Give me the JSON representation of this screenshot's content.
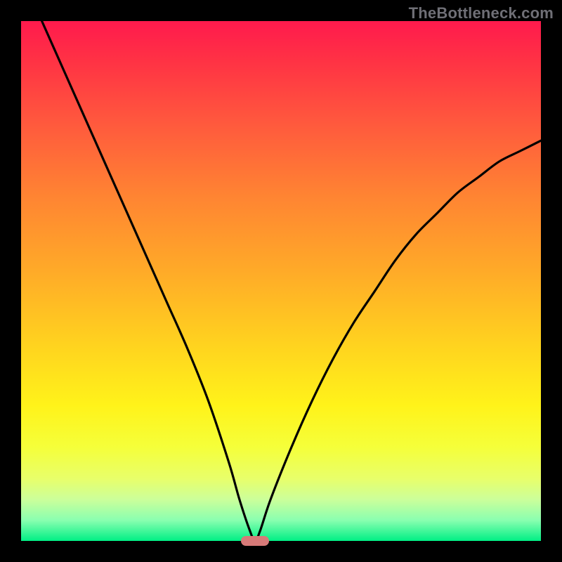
{
  "watermark": "TheBottleneck.com",
  "colors": {
    "frame": "#000000",
    "gradient_top": "#ff1a4d",
    "gradient_bottom": "#00ef85",
    "curve": "#000000",
    "marker": "#d77a78",
    "watermark": "#6f6f76"
  },
  "chart_data": {
    "type": "line",
    "title": "",
    "xlabel": "",
    "ylabel": "",
    "xlim": [
      0,
      100
    ],
    "ylim": [
      0,
      100
    ],
    "grid": false,
    "legend": false,
    "series": [
      {
        "name": "bottleneck-curve",
        "x": [
          4,
          8,
          12,
          16,
          20,
          24,
          28,
          32,
          36,
          40,
          42,
          44,
          45,
          46,
          48,
          52,
          56,
          60,
          64,
          68,
          72,
          76,
          80,
          84,
          88,
          92,
          96,
          100
        ],
        "values": [
          100,
          91,
          82,
          73,
          64,
          55,
          46,
          37,
          27,
          15,
          8,
          2,
          0,
          2,
          8,
          18,
          27,
          35,
          42,
          48,
          54,
          59,
          63,
          67,
          70,
          73,
          75,
          77
        ]
      }
    ],
    "marker": {
      "x": 45,
      "y": 0,
      "shape": "pill"
    },
    "annotations": [
      {
        "text": "TheBottleneck.com",
        "role": "watermark",
        "position": "top-right"
      }
    ]
  }
}
